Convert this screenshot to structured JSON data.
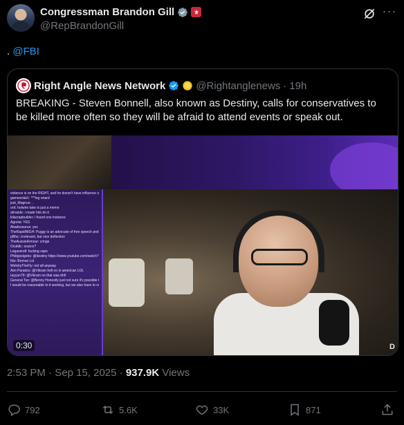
{
  "author": {
    "display_name": "Congressman Brandon Gill",
    "handle": "@RepBrandonGill"
  },
  "tweet": {
    "text_prefix": ". ",
    "mention": "@FBI"
  },
  "quote": {
    "author_name": "Right Angle News Network",
    "handle": "@Rightanglenews",
    "separator": "·",
    "time": "19h",
    "text": "BREAKING - Steven Bonnell, also known as Destiny, calls for conservatives to be killed more often so they will be afraid to attend events or speak out.",
    "video": {
      "time_label": "0:30",
      "corner_label": "D",
      "chat_lines": [
        "violence is on the RIGHT, and he doesn't have influence over them",
        "gamesclab1: ***ing retard",
        "just_Magnus: ..",
        "ord: hotwire take is just a meme",
        "afroside: i made him do it",
        "kilacrapbuilder: i found one instance",
        "Agonia: YES",
        "Akadosaurus: yes",
        "TheRapidNIGH: Puggy is an advocate of free speech and pure intelligence",
        "pBfsc: irrelevant, but nice deflection",
        "TheAussieArmour: cringe",
        "Oculdic: source?",
        "Legaverell: fucking vapo",
        "PhilippsIgebs: @destiny https://www.youtube.com/watch?",
        "Nio: Bronse Lol",
        "WelshyTheFly: not all anyway",
        "Aim Paradox: @Vikram hell no in american LOL",
        "rayyun79: @Vikram no that was drill",
        "General Tso: @Benny Honestly just not sure it's possible that any media environment was coordinated",
        "I would be reasonable to it working, but we also have to reckon with the fact Trump wasn't punished for J6"
      ]
    }
  },
  "meta": {
    "time": "2:53 PM",
    "separator": "·",
    "date": "Sep 15, 2025",
    "separator2": "·",
    "views_count": "937.9K",
    "views_label": "Views"
  },
  "actions": {
    "replies": "792",
    "reposts": "5.6K",
    "likes": "33K",
    "bookmarks": "871"
  },
  "colors": {
    "accent": "#1d9bf0",
    "muted": "#71767b",
    "text": "#e7e9ea",
    "background": "#000000"
  }
}
